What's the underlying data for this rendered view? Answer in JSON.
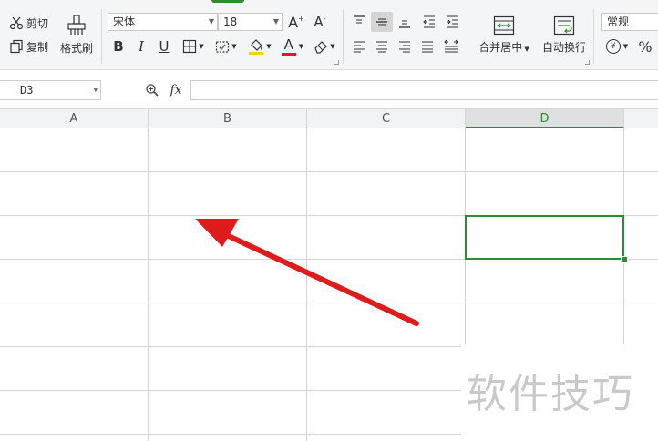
{
  "clipboard": {
    "cut_label": "剪切",
    "copy_label": "复制",
    "format_painter_label": "格式刷"
  },
  "font": {
    "family": "宋体",
    "size": "18",
    "grow_glyph": "A",
    "shrink_glyph": "A",
    "bold": "B",
    "italic": "I",
    "underline": "U",
    "color_glyph": "A"
  },
  "alignment": {
    "merge_label": "合并居中",
    "wrap_label": "自动换行"
  },
  "number": {
    "format": "常规",
    "currency_glyph": "¥",
    "percent_glyph": "%"
  },
  "formula_bar": {
    "cell_ref": "D3",
    "fx_label": "fx",
    "value": ""
  },
  "columns": [
    {
      "label": "A"
    },
    {
      "label": "B"
    },
    {
      "label": "C"
    },
    {
      "label": "D"
    }
  ],
  "selected_column": "D",
  "selected_cell": "D3",
  "colors": {
    "accent": "#2e8b32",
    "arrow": "#e01b1b",
    "font_color_bar": "#e01b1b",
    "highlight_bar": "#f5d400"
  },
  "watermark": "软件技巧"
}
